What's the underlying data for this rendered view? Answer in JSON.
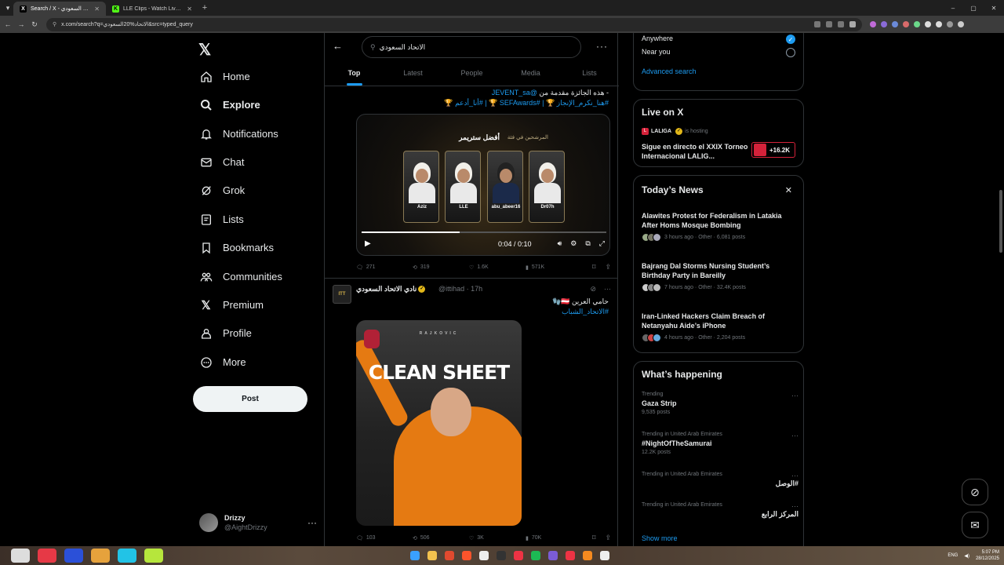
{
  "browser": {
    "tabs": [
      {
        "title": "Search / X - الاتحاد السعودي",
        "icon": "X",
        "active": true
      },
      {
        "title": "LLE Clips - Watch Live on Kick",
        "icon": "K",
        "active": false
      }
    ],
    "url": "x.com/search?q=الاتحاد%20السعودي&src=typed_query"
  },
  "nav": {
    "items": [
      {
        "label": "Home",
        "icon": "home-icon"
      },
      {
        "label": "Explore",
        "icon": "search-icon"
      },
      {
        "label": "Notifications",
        "icon": "bell-icon"
      },
      {
        "label": "Chat",
        "icon": "mail-icon"
      },
      {
        "label": "Grok",
        "icon": "grok-icon"
      },
      {
        "label": "Lists",
        "icon": "list-icon"
      },
      {
        "label": "Bookmarks",
        "icon": "bookmark-icon"
      },
      {
        "label": "Communities",
        "icon": "people-icon"
      },
      {
        "label": "Premium",
        "icon": "x-icon"
      },
      {
        "label": "Profile",
        "icon": "user-icon"
      },
      {
        "label": "More",
        "icon": "more-circle-icon"
      }
    ],
    "post_label": "Post",
    "account": {
      "name": "Drizzy",
      "handle": "@AightDrizzy"
    }
  },
  "search": {
    "query": "الاتحاد السعودي",
    "tabs": [
      "Top",
      "Latest",
      "People",
      "Media",
      "Lists"
    ],
    "active_tab": "Top"
  },
  "tweet1": {
    "line1": "- هذه الجائزة مقدمة من ",
    "line1_link": "@JEVENT_sa",
    "line2_links": "#هنا_نكرم_الإنجاز 🏆 | #SEFAwards 🏆 | #أنا_أدعم 🏆",
    "media": {
      "title": "أفضل ستريمر",
      "subtitle": "المرشحين في فئة",
      "candidates": [
        "Aziz",
        "LLE",
        "abu_abeer16",
        "Dr07h"
      ],
      "time": "0:04 / 0:10",
      "progress": 0.4
    },
    "stats": {
      "replies": "271",
      "reposts": "319",
      "likes": "1.6K",
      "views": "571K"
    }
  },
  "tweet2": {
    "name": "نادي الاتحاد السعودي",
    "handle": "@ittihad · 17h",
    "line1": "حامي العرين 🇦🇹🧤",
    "hashtag": "#الاتحاد_الشباب",
    "media": {
      "small": "RAJKOVIC",
      "big": "CLEAN SHEET"
    },
    "stats": {
      "replies": "103",
      "reposts": "506",
      "likes": "3K",
      "views": "70K"
    }
  },
  "right": {
    "location": {
      "anywhere": "Anywhere",
      "near": "Near you",
      "advanced": "Advanced search"
    },
    "live": {
      "title": "Live on X",
      "host": "LALIGA",
      "hosting": "is hosting",
      "stream_title": "Sigue en directo el XXIX Torneo Internacional LALIG...",
      "count": "+16.2K"
    },
    "news": {
      "title": "Today’s News",
      "items": [
        {
          "headline": "Alawites Protest for Federalism in Latakia After Homs Mosque Bombing",
          "meta": "3 hours ago · Other · 6,081 posts"
        },
        {
          "headline": "Bajrang Dal Storms Nursing Student’s Birthday Party in Bareilly",
          "meta": "7 hours ago · Other · 32.4K posts"
        },
        {
          "headline": "Iran-Linked Hackers Claim Breach of Netanyahu Aide’s iPhone",
          "meta": "4 hours ago · Other · 2,204 posts"
        }
      ]
    },
    "happening": {
      "title": "What’s happening",
      "trends": [
        {
          "context": "Trending",
          "name": "Gaza Strip",
          "posts": "9,535 posts"
        },
        {
          "context": "Trending in United Arab Emirates",
          "name": "#NightOfTheSamurai",
          "posts": "12.2K posts"
        },
        {
          "context": "Trending in United Arab Emirates",
          "name": "#الوصل",
          "posts": ""
        },
        {
          "context": "Trending in United Arab Emirates",
          "name": "المركز الرابع",
          "posts": ""
        }
      ],
      "show_more": "Show more"
    }
  },
  "taskbar": {
    "lang": "ENG",
    "time": "5:07 PM",
    "date": "28/12/2025"
  }
}
